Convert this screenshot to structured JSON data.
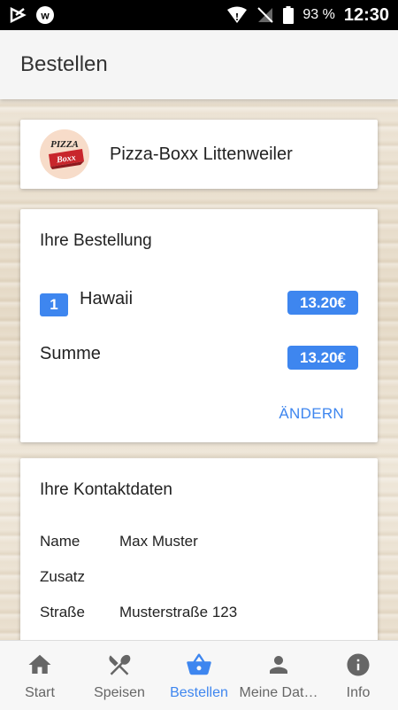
{
  "status_bar": {
    "battery": "93 %",
    "time": "12:30"
  },
  "app_bar": {
    "title": "Bestellen"
  },
  "restaurant": {
    "name": "Pizza-Boxx Littenweiler",
    "logo_text_top": "PIZZA",
    "logo_text_bottom": "Boxx"
  },
  "order": {
    "title": "Ihre Bestellung",
    "items": [
      {
        "qty": "1",
        "name": "Hawaii",
        "price": "13.20€"
      }
    ],
    "sum_label": "Summe",
    "sum_value": "13.20€",
    "change_label": "ÄNDERN"
  },
  "contact": {
    "title": "Ihre Kontaktdaten",
    "rows": [
      {
        "label": "Name",
        "value": "Max Muster"
      },
      {
        "label": "Zusatz",
        "value": ""
      },
      {
        "label": "Straße",
        "value": "Musterstraße 123"
      }
    ]
  },
  "bottom_nav": {
    "items": [
      {
        "label": "Start",
        "icon": "home-icon"
      },
      {
        "label": "Speisen",
        "icon": "cutlery-icon"
      },
      {
        "label": "Bestellen",
        "icon": "basket-icon",
        "active": true
      },
      {
        "label": "Meine Dat…",
        "icon": "person-icon"
      },
      {
        "label": "Info",
        "icon": "info-icon"
      }
    ]
  },
  "colors": {
    "accent": "#3e86ef",
    "appbar": "#f5f5f5"
  }
}
